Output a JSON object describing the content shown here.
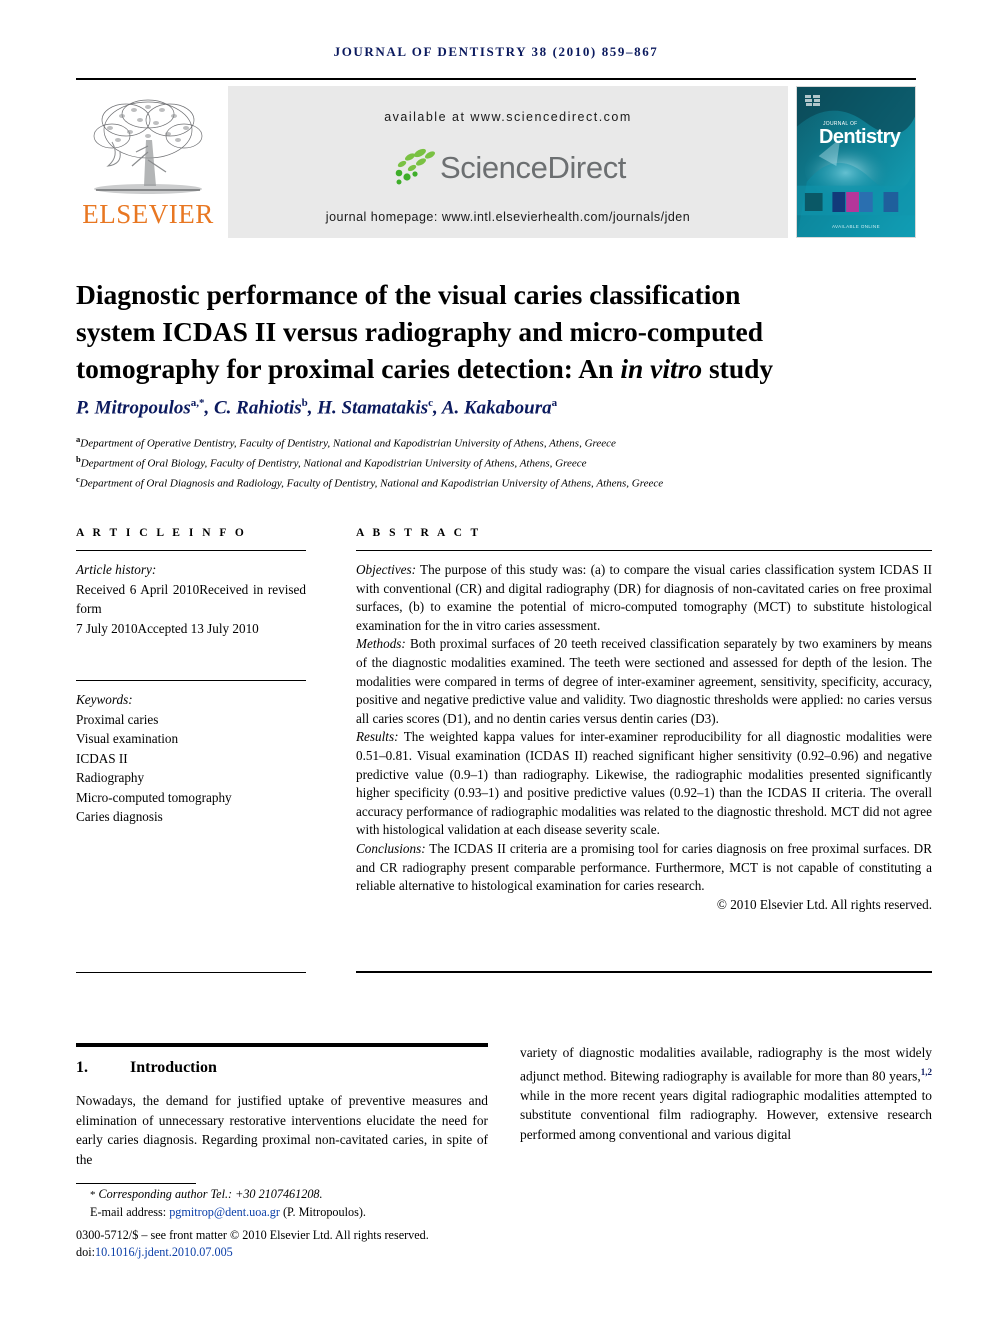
{
  "running_head": "JOURNAL OF DENTISTRY 38 (2010) 859–867",
  "masthead": {
    "publisher_name": "ELSEVIER",
    "available_at": "available at www.sciencedirect.com",
    "sciencedirect_wordmark": "ScienceDirect",
    "journal_homepage": "journal homepage: www.intl.elsevierhealth.com/journals/jden",
    "cover": {
      "kicker": "JOURNAL OF",
      "title": "Dentistry",
      "footer": "AVAILABLE ONLINE"
    },
    "colors": {
      "elsevier_orange": "#E87722",
      "sciencedirect_green": "#4CAF50",
      "sciencedirect_gray": "#6c6f71",
      "banner_gray": "#e9e9e9",
      "cover_teal": "#0b6a78"
    }
  },
  "article": {
    "title_line1": "Diagnostic performance of the visual caries classification",
    "title_line2": "system ICDAS II versus radiography and micro-computed",
    "title_line3_a": "tomography for proximal caries detection: An ",
    "title_line3_italic": "in vitro",
    "title_line3_b": " study",
    "authors": [
      {
        "name": "P. Mitropoulos",
        "marks": "a,*"
      },
      {
        "name": "C. Rahiotis",
        "marks": "b"
      },
      {
        "name": "H. Stamatakis",
        "marks": "c"
      },
      {
        "name": "A. Kakaboura",
        "marks": "a"
      }
    ],
    "affiliations": [
      {
        "mark": "a",
        "text": "Department of Operative Dentistry, Faculty of Dentistry, National and Kapodistrian University of Athens, Athens, Greece"
      },
      {
        "mark": "b",
        "text": "Department of Oral Biology, Faculty of Dentistry, National and Kapodistrian University of Athens, Athens, Greece"
      },
      {
        "mark": "c",
        "text": "Department of Oral Diagnosis and Radiology, Faculty of Dentistry, National and Kapodistrian University of Athens, Athens, Greece"
      }
    ]
  },
  "article_info": {
    "heading": "A R T I C L E   I N F O",
    "history_label": "Article history:",
    "history_line1": "Received 6 April 2010Received in revised form",
    "history_line2": "7 July 2010Accepted 13 July 2010",
    "keywords_label": "Keywords:",
    "keywords": [
      "Proximal caries",
      "Visual examination",
      "ICDAS II",
      "Radiography",
      "Micro-computed tomography",
      "Caries diagnosis"
    ]
  },
  "abstract": {
    "heading": "A B S T R A C T",
    "objectives_label": "Objectives:",
    "objectives_text": " The purpose of this study was: (a) to compare the visual caries classification system ICDAS II with conventional (CR) and digital radiography (DR) for diagnosis of non-cavitated caries on free proximal surfaces, (b) to examine the potential of micro-computed tomography (MCT) to substitute histological examination for the in vitro caries assessment.",
    "methods_label": "Methods:",
    "methods_text": " Both proximal surfaces of 20 teeth received classification separately by two examiners by means of the diagnostic modalities examined. The teeth were sectioned and assessed for depth of the lesion. The modalities were compared in terms of degree of inter-examiner agreement, sensitivity, specificity, accuracy, positive and negative predictive value and validity. Two diagnostic thresholds were applied: no caries versus all caries scores (D1), and no dentin caries versus dentin caries (D3).",
    "results_label": "Results:",
    "results_text": " The weighted kappa values for inter-examiner reproducibility for all diagnostic modalities were 0.51–0.81. Visual examination (ICDAS II) reached significant higher sensitivity (0.92–0.96) and negative predictive value (0.9–1) than radiography. Likewise, the radiographic modalities presented significantly higher specificity (0.93–1) and positive predictive values (0.92–1) than the ICDAS II criteria. The overall accuracy performance of radiographic modalities was related to the diagnostic threshold. MCT did not agree with histological validation at each disease severity scale.",
    "conclusions_label": "Conclusions:",
    "conclusions_text": " The ICDAS II criteria are a promising tool for caries diagnosis on free proximal surfaces. DR and CR radiography present comparable performance. Furthermore, MCT is not capable of constituting a reliable alternative to histological examination for caries research.",
    "copyright": "© 2010 Elsevier Ltd. All rights reserved."
  },
  "body": {
    "section_number": "1.",
    "section_title": "Introduction",
    "left_paragraph": "Nowadays, the demand for justified uptake of preventive measures and elimination of unnecessary restorative interventions elucidate the need for early caries diagnosis. Regarding proximal non-cavitated caries, in spite of the",
    "right_paragraph_a": "variety of diagnostic modalities available, radiography is the most widely adjunct method. Bitewing radiography is available for more than 80 years,",
    "right_paragraph_ref": "1,2",
    "right_paragraph_b": " while in the more recent years digital radiographic modalities attempted to substitute conventional film radiography. However, extensive research performed among conventional and various digital"
  },
  "footer": {
    "corresponding_marker": "*",
    "corresponding_text": "Corresponding author Tel.: +30 2107461208.",
    "email_label": "E-mail address:",
    "email": "pgmitrop@dent.uoa.gr",
    "email_owner": "(P. Mitropoulos).",
    "front_matter": "0300-5712/$ – see front matter © 2010 Elsevier Ltd. All rights reserved.",
    "doi_label": "doi:",
    "doi": "10.1016/j.jdent.2010.07.005"
  }
}
